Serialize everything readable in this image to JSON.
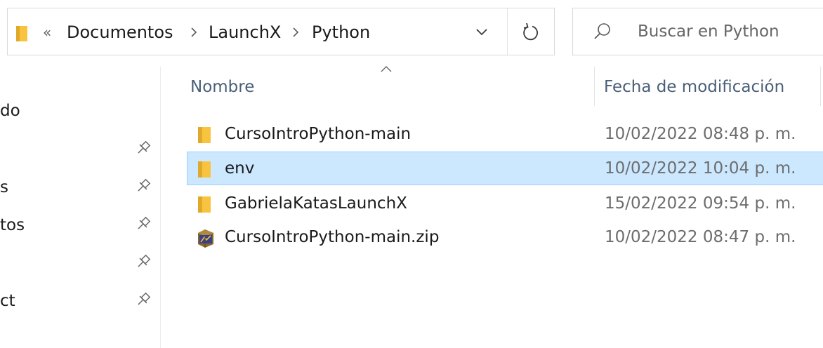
{
  "address_bar": {
    "overflow_chevrons": "«",
    "breadcrumbs": [
      "Documentos",
      "LaunchX",
      "Python"
    ]
  },
  "search": {
    "placeholder": "Buscar en Python",
    "value": ""
  },
  "nav_pane": {
    "items": [
      {
        "label": "do",
        "pinned": false
      },
      {
        "label": "",
        "pinned": true
      },
      {
        "label": "s",
        "pinned": true
      },
      {
        "label": "tos",
        "pinned": true
      },
      {
        "label": "",
        "pinned": true
      },
      {
        "label": "ct",
        "pinned": true
      }
    ]
  },
  "columns": {
    "name": "Nombre",
    "modified": "Fecha de modificación",
    "sort_column": "name"
  },
  "files": [
    {
      "name": "CursoIntroPython-main",
      "modified": "10/02/2022 08:48 p. m.",
      "type": "folder-icon",
      "selected": false
    },
    {
      "name": "env",
      "modified": "10/02/2022 10:04 p. m.",
      "type": "folder-icon",
      "selected": true
    },
    {
      "name": "GabrielaKatasLaunchX",
      "modified": "15/02/2022 09:54 p. m.",
      "type": "folder-icon",
      "selected": false
    },
    {
      "name": "CursoIntroPython-main.zip",
      "modified": "10/02/2022 08:47 p. m.",
      "type": "zip-archive-icon",
      "selected": false
    }
  ],
  "colors": {
    "selection_background": "#cce8ff",
    "selection_border": "#99d1ff",
    "folder_yellow": "#f8c440",
    "header_text": "#4a5f78"
  }
}
